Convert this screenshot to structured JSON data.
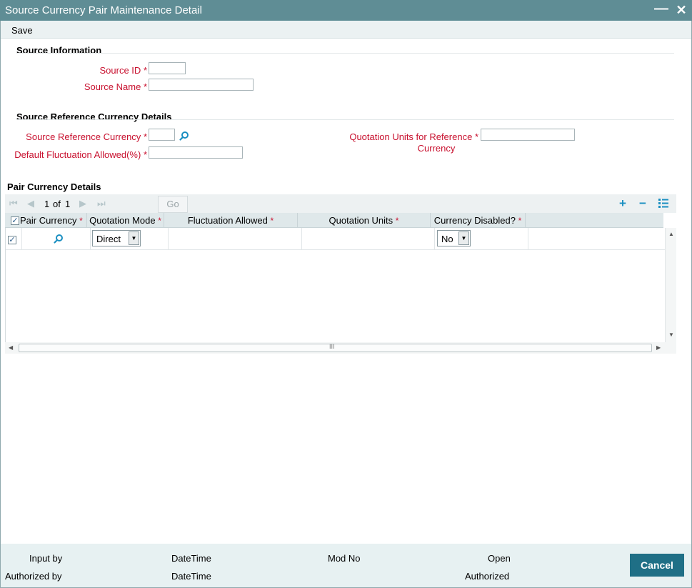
{
  "window": {
    "title": "Source Currency Pair Maintenance Detail",
    "minimize_glyph": "—",
    "close_glyph": "✕"
  },
  "toolbar": {
    "save_label": "Save"
  },
  "source_information": {
    "title": "Source Information",
    "source_id_label": "Source ID",
    "source_id_value": "",
    "source_name_label": "Source Name",
    "source_name_value": ""
  },
  "reference_currency": {
    "title": "Source Reference Currency Details",
    "currency_label": "Source Reference Currency",
    "currency_value": "",
    "fluctuation_label": "Default Fluctuation Allowed(%)",
    "fluctuation_value": "",
    "quotation_units_label_line1": "Quotation Units for Reference",
    "quotation_units_label_line2": "Currency",
    "quotation_units_value": ""
  },
  "required_marker": "*",
  "pair_currency": {
    "title": "Pair Currency Details",
    "pagination": {
      "current": "1",
      "of_label": "of",
      "total": "1",
      "go_label": "Go"
    },
    "columns": [
      {
        "label": "Pair Currency"
      },
      {
        "label": "Quotation Mode"
      },
      {
        "label": "Fluctuation Allowed"
      },
      {
        "label": "Quotation Units"
      },
      {
        "label": "Currency Disabled?"
      }
    ],
    "rows": [
      {
        "checked": true,
        "pair_currency": "",
        "quotation_mode": "Direct",
        "fluctuation_allowed": "",
        "quotation_units": "",
        "currency_disabled": "No"
      }
    ],
    "icons": [
      "add-row-icon",
      "delete-row-icon",
      "single-view-icon"
    ],
    "scroll_grip": "III"
  },
  "footer": {
    "input_by_label": "Input by",
    "datetime_label_1": "DateTime",
    "mod_no_label": "Mod No",
    "open_label": "Open",
    "authorized_by_label": "Authorized by",
    "datetime_label_2": "DateTime",
    "authorized_label": "Authorized",
    "cancel_label": "Cancel"
  },
  "colors": {
    "titlebar": "#5f8d95",
    "required_label": "#c8102e",
    "accent_icon": "#1a8fc1",
    "cancel_button": "#1f6f86",
    "footer_bg": "#e7f1f2"
  }
}
